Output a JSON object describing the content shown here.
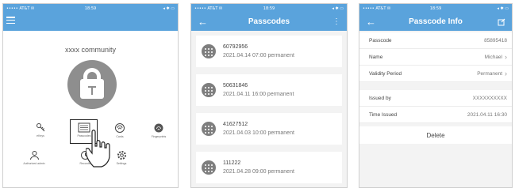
{
  "screen1": {
    "status": {
      "carrier": "••••• AT&T ✉",
      "time": "18:59",
      "battery": "◂ ✱ ▭"
    },
    "community_name": "xxxx community",
    "features": [
      {
        "label": "eKeys"
      },
      {
        "label": "Passcodes"
      },
      {
        "label": "Cards"
      },
      {
        "label": "Fingerprints"
      },
      {
        "label": "Authorized admin"
      },
      {
        "label": "Records"
      },
      {
        "label": "Settings"
      }
    ]
  },
  "screen2": {
    "status": {
      "carrier": "••••• AT&T ✉",
      "time": "18:59",
      "battery": "◂ ✱ ▭"
    },
    "title": "Passcodes",
    "items": [
      {
        "code": "60792956",
        "date": "2021.04.14 07:00 permanent"
      },
      {
        "code": "50631846",
        "date": "2021.04.11 16:00 permanent"
      },
      {
        "code": "41627512",
        "date": "2021.04.03 10:00 permanent"
      },
      {
        "code": "111222",
        "date": "2021.04.28 09:00 permanent"
      }
    ]
  },
  "screen3": {
    "status": {
      "carrier": "••••• AT&T ✉",
      "time": "18:59",
      "battery": "◂ ✱ ▭"
    },
    "title": "Passcode Info",
    "rows": [
      {
        "key": "Passcode",
        "value": "85895418"
      },
      {
        "key": "Name",
        "value": "Michael"
      },
      {
        "key": "Validity Period",
        "value": "Permanent"
      }
    ],
    "rows2": [
      {
        "key": "Issued by",
        "value": "XXXXXXXXXX"
      },
      {
        "key": "Time Issued",
        "value": "2021.04.11 16:30"
      }
    ],
    "delete_label": "Delete"
  },
  "colors": {
    "accent": "#5aa3dc",
    "icon_grey": "#8e8e8e"
  }
}
